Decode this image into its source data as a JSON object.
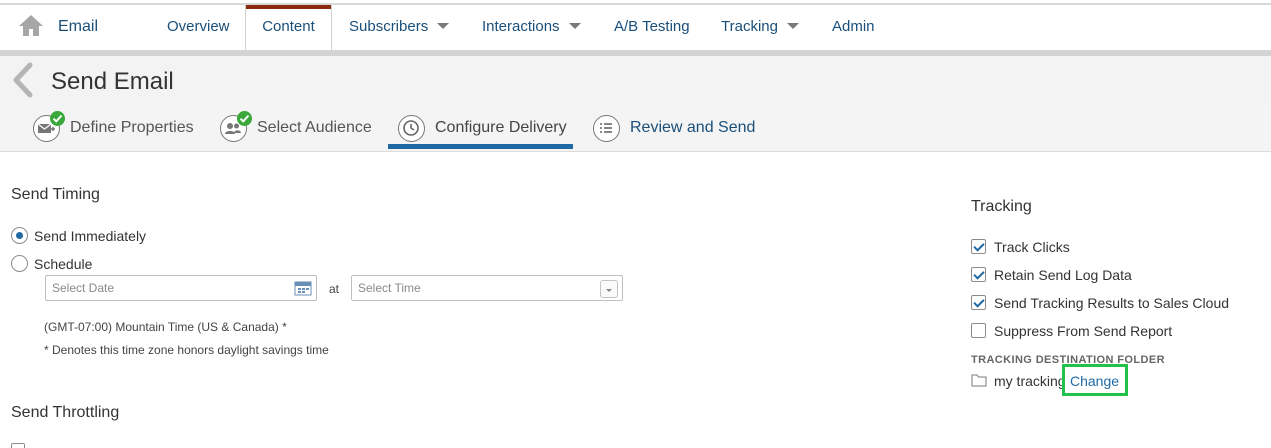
{
  "nav": {
    "app_name": "Email",
    "items": [
      {
        "label": "Overview"
      },
      {
        "label": "Content"
      },
      {
        "label": "Subscribers"
      },
      {
        "label": "Interactions"
      },
      {
        "label": "A/B Testing"
      },
      {
        "label": "Tracking"
      },
      {
        "label": "Admin"
      }
    ],
    "active": "Content"
  },
  "header": {
    "title": "Send Email"
  },
  "steps": [
    {
      "label": "Define Properties",
      "status": "complete",
      "icon": "envelope-icon"
    },
    {
      "label": "Select Audience",
      "status": "complete",
      "icon": "people-icon"
    },
    {
      "label": "Configure Delivery",
      "status": "active",
      "icon": "clock-icon"
    },
    {
      "label": "Review and Send",
      "status": "pending",
      "icon": "list-icon"
    }
  ],
  "send_timing": {
    "title": "Send Timing",
    "options": [
      {
        "label": "Send Immediately",
        "selected": true
      },
      {
        "label": "Schedule",
        "selected": false
      }
    ],
    "date_placeholder": "Select Date",
    "at_label": "at",
    "time_placeholder": "Select Time",
    "timezone_note": "(GMT-07:00) Mountain Time (US & Canada) *",
    "dst_note": "* Denotes this time zone honors daylight savings time"
  },
  "send_throttling": {
    "title": "Send Throttling"
  },
  "tracking": {
    "title": "Tracking",
    "options": [
      {
        "label": "Track Clicks",
        "checked": true
      },
      {
        "label": "Retain Send Log Data",
        "checked": true
      },
      {
        "label": "Send Tracking Results to Sales Cloud",
        "checked": true
      },
      {
        "label": "Suppress From Send Report",
        "checked": false
      }
    ],
    "folder_label": "TRACKING DESTINATION FOLDER",
    "folder_name": "my tracking",
    "change_label": "Change"
  },
  "colors": {
    "nav_text": "#1a4f7a",
    "active_tab_bar": "#8a2b0c",
    "step_underline": "#1f6aa5",
    "complete_check": "#3aa83a",
    "highlight_box": "#22c24a"
  }
}
